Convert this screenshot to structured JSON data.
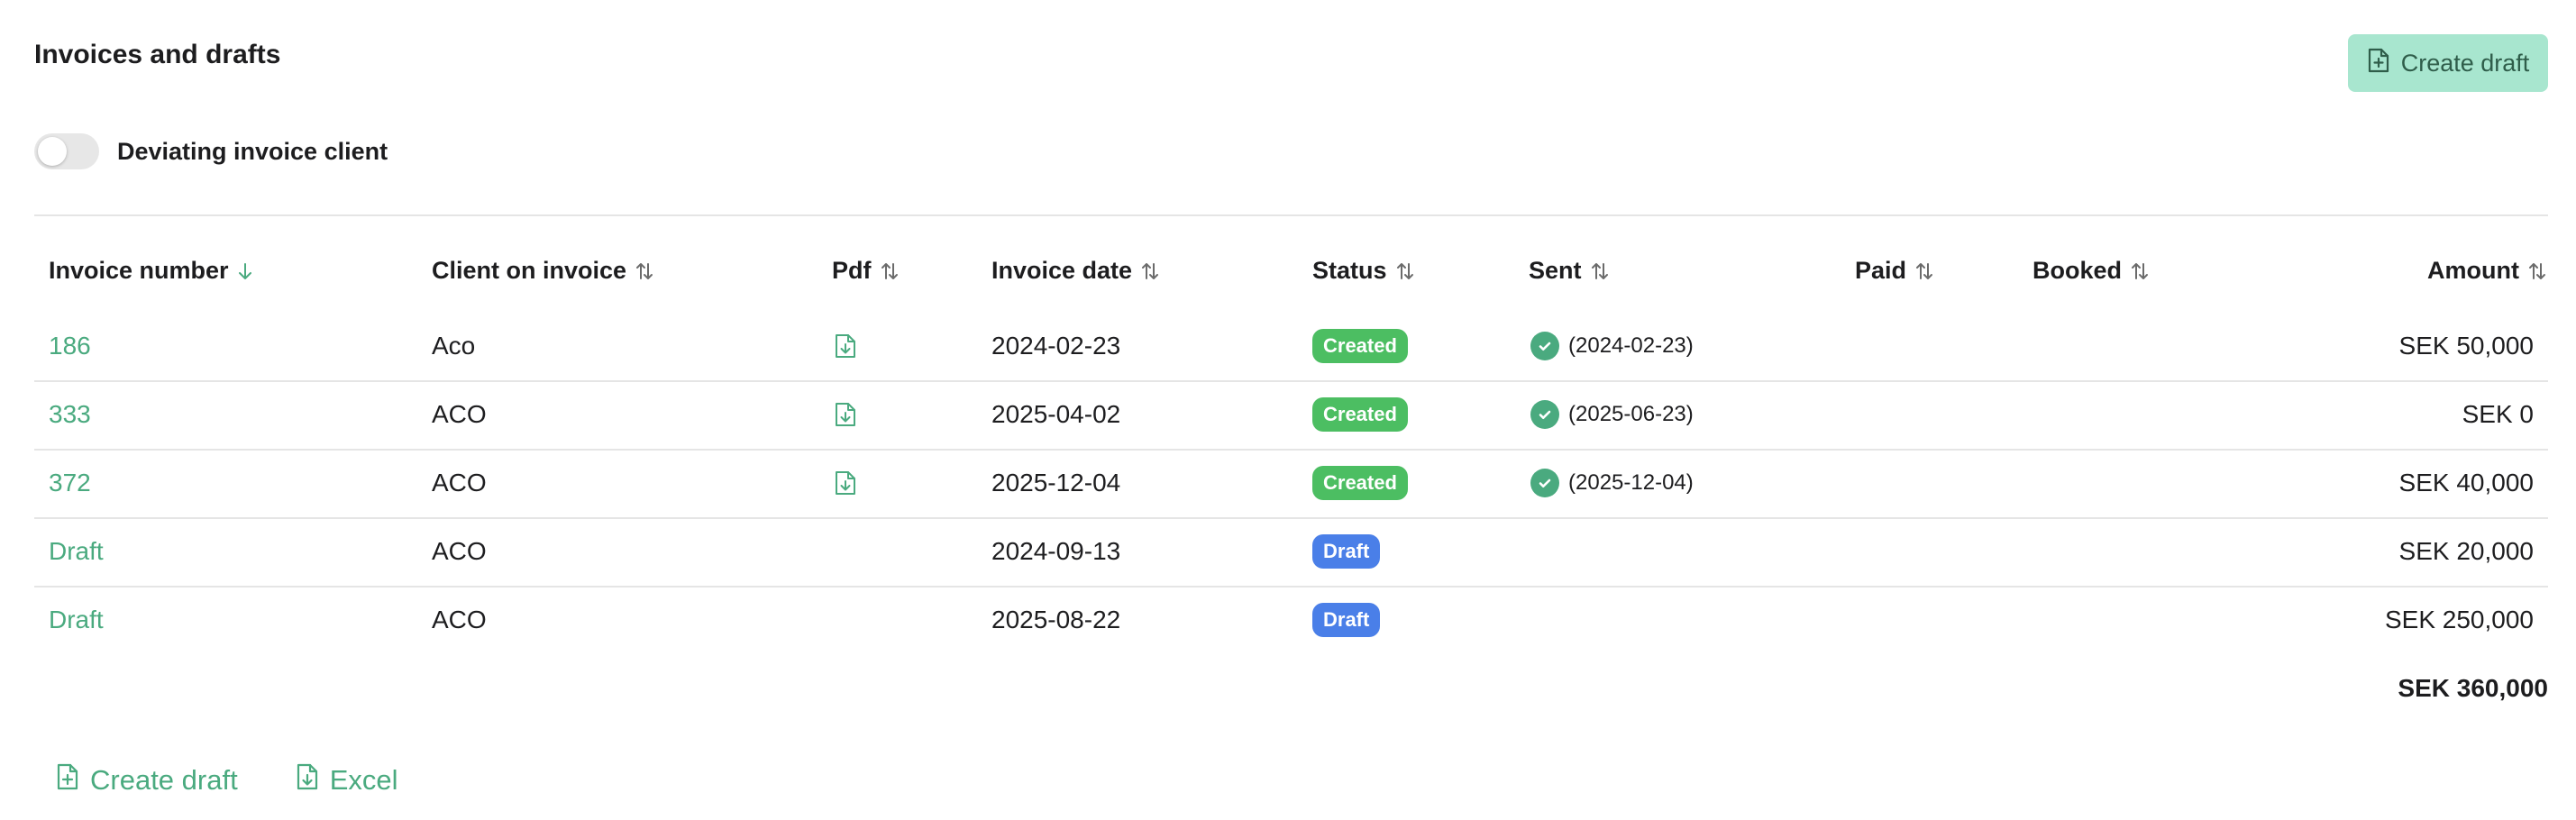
{
  "page": {
    "title": "Invoices and drafts",
    "create_draft_label": "Create draft",
    "toggle_label": "Deviating invoice client"
  },
  "colors": {
    "accent": "#4aaa7f",
    "created_badge": "#4cbe62",
    "draft_badge": "#4a7fe8",
    "button_bg": "#a8e6cf"
  },
  "table": {
    "headers": {
      "invoice_number": "Invoice number",
      "client": "Client on invoice",
      "pdf": "Pdf",
      "invoice_date": "Invoice date",
      "status": "Status",
      "sent": "Sent",
      "paid": "Paid",
      "booked": "Booked",
      "amount": "Amount"
    },
    "rows": [
      {
        "number": "186",
        "client": "Aco",
        "pdf": true,
        "date": "2024-02-23",
        "status": "Created",
        "status_kind": "created",
        "sent": "(2024-02-23)",
        "amount": "SEK 50,000"
      },
      {
        "number": "333",
        "client": "ACO",
        "pdf": true,
        "date": "2025-04-02",
        "status": "Created",
        "status_kind": "created",
        "sent": "(2025-06-23)",
        "amount": "SEK 0"
      },
      {
        "number": "372",
        "client": "ACO",
        "pdf": true,
        "date": "2025-12-04",
        "status": "Created",
        "status_kind": "created",
        "sent": "(2025-12-04)",
        "amount": "SEK 40,000"
      },
      {
        "number": "Draft",
        "client": "ACO",
        "pdf": false,
        "date": "2024-09-13",
        "status": "Draft",
        "status_kind": "draft",
        "sent": "",
        "amount": "SEK 20,000"
      },
      {
        "number": "Draft",
        "client": "ACO",
        "pdf": false,
        "date": "2025-08-22",
        "status": "Draft",
        "status_kind": "draft",
        "sent": "",
        "amount": "SEK 250,000"
      }
    ],
    "total": "SEK 360,000"
  },
  "footer": {
    "create_draft_label": "Create draft",
    "excel_label": "Excel"
  },
  "icons": {
    "sort_active": "arrow-down-icon",
    "sort_inactive": "sort-arrows-icon",
    "pdf": "file-download-icon",
    "sent": "check-circle-icon",
    "create": "file-plus-icon",
    "excel": "file-download-icon"
  }
}
